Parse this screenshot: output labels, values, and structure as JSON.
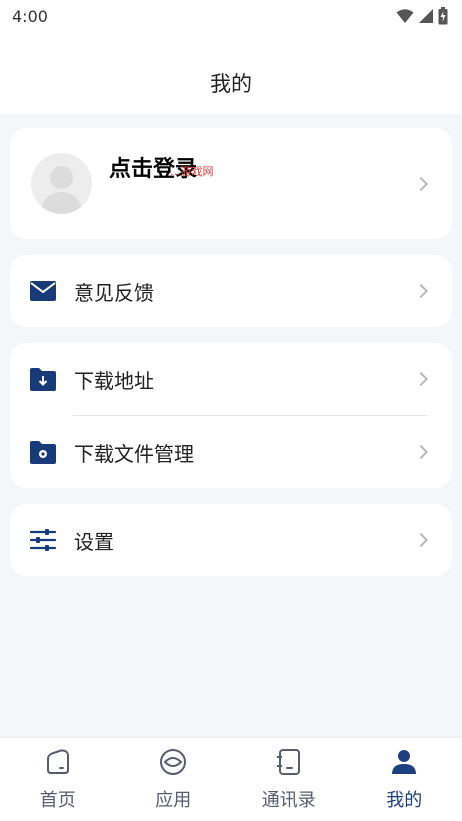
{
  "status_bar": {
    "time": "4:00"
  },
  "header": {
    "title": "我的"
  },
  "profile": {
    "login_label": "点击登录",
    "watermark": "...游戏网"
  },
  "menu": {
    "feedback": "意见反馈",
    "download_address": "下载地址",
    "download_file_manage": "下载文件管理",
    "settings": "设置"
  },
  "tabs": [
    {
      "label": "首页",
      "icon": "home-icon"
    },
    {
      "label": "应用",
      "icon": "apps-icon"
    },
    {
      "label": "通讯录",
      "icon": "contacts-icon"
    },
    {
      "label": "我的",
      "icon": "profile-icon",
      "active": true
    }
  ],
  "colors": {
    "accent": "#1e3f7f",
    "icon_navy": "#183a78",
    "background": "#f5f6f8"
  }
}
